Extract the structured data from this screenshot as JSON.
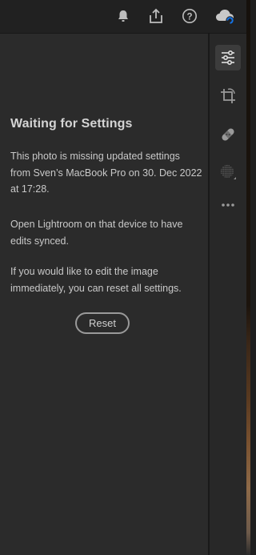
{
  "topbar": {
    "icons": [
      "bell-icon",
      "share-icon",
      "help-icon",
      "cloud-sync-icon"
    ],
    "help_glyph": "?"
  },
  "panel": {
    "title": "Waiting for Settings",
    "message_1": "This photo is missing updated settings from Sven’s MacBook Pro on 30. Dec 2022 at 17:28.",
    "message_2": "Open Lightroom on that device to have edits synced.",
    "message_3": "If you would like to edit the image immediately, you can reset all settings.",
    "reset_label": "Reset"
  },
  "toolstrip": {
    "tools": [
      "edit-sliders-icon",
      "crop-rotate-icon",
      "healing-bandage-icon",
      "masking-icon",
      "more-icon"
    ],
    "active_tool": "edit-sliders-icon"
  },
  "colors": {
    "panel_bg": "#2b2b2b",
    "topbar_bg": "#212121",
    "text": "#c9c9c9",
    "accent_blue": "#1473e6"
  }
}
